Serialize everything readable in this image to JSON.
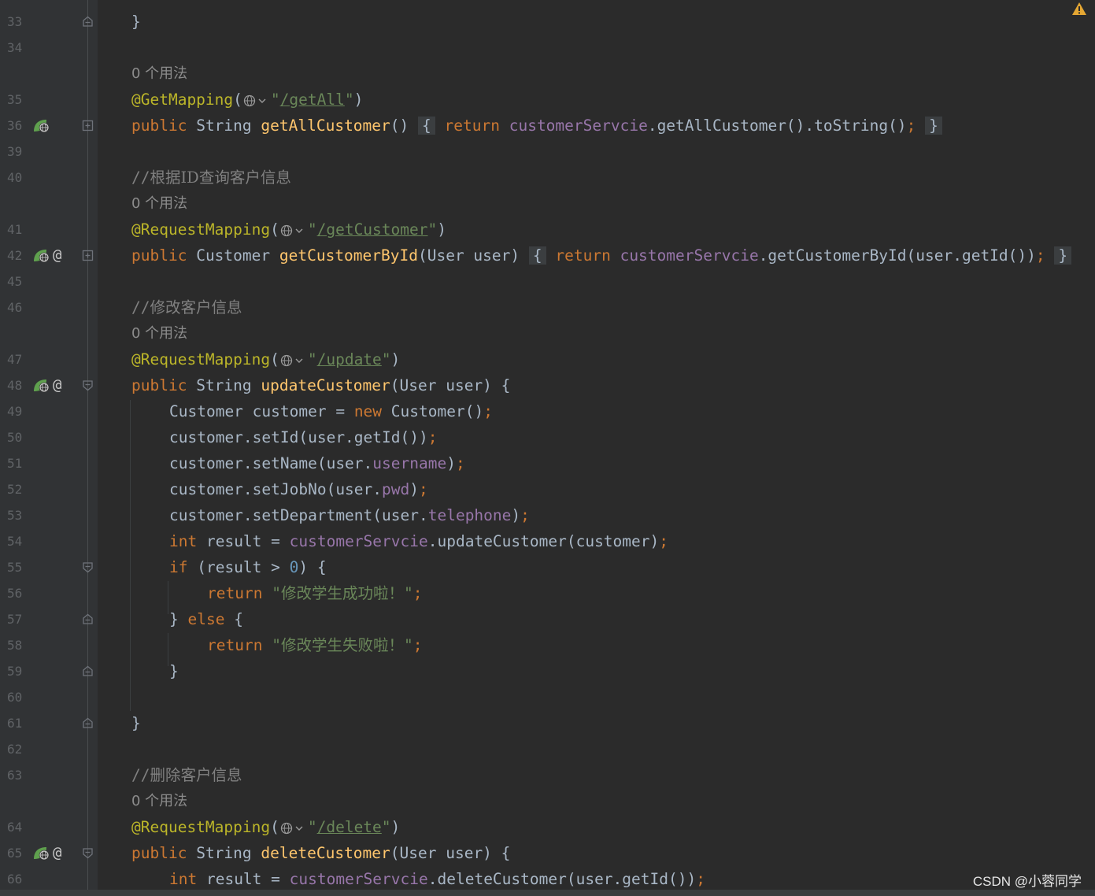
{
  "editor": {
    "usage_hint": "0 个用法",
    "lines": {
      "l33": {
        "num": "33",
        "code": "}"
      },
      "l34": {
        "num": "34"
      },
      "l35": {
        "num": "35",
        "ann": "@GetMapping",
        "url": "/getAll"
      },
      "l36": {
        "num": "36",
        "kw_public": "public",
        "type": "String",
        "method": "getAllCustomer",
        "kw_return": "return",
        "field": "customerServcie",
        "call": ".getAllCustomer().toString()",
        "semi": ";"
      },
      "l39": {
        "num": "39"
      },
      "l40": {
        "num": "40",
        "comment_prefix": "//",
        "comment": "根据ID查询客户信息"
      },
      "l41": {
        "num": "41",
        "ann": "@RequestMapping",
        "url": "/getCustomer"
      },
      "l42": {
        "num": "42",
        "kw_public": "public",
        "type": "Customer",
        "method": "getCustomerById",
        "params": "(User user)",
        "kw_return": "return",
        "field": "customerServcie",
        "call": ".getCustomerById(user.getId())",
        "semi": ";"
      },
      "l45": {
        "num": "45"
      },
      "l46": {
        "num": "46",
        "comment_prefix": "//",
        "comment": "修改客户信息"
      },
      "l47": {
        "num": "47",
        "ann": "@RequestMapping",
        "url": "/update"
      },
      "l48": {
        "num": "48",
        "kw_public": "public",
        "type": "String",
        "method": "updateCustomer",
        "params": "(User user) {"
      },
      "l49": {
        "num": "49",
        "a": "Customer customer = ",
        "kw": "new",
        "b": " Customer()",
        "semi": ";"
      },
      "l50": {
        "num": "50",
        "a": "customer.setId(user.getId())",
        "semi": ";"
      },
      "l51": {
        "num": "51",
        "a": "customer.setName(user.",
        "field": "username",
        "b": ")",
        "semi": ";"
      },
      "l52": {
        "num": "52",
        "a": "customer.setJobNo(user.",
        "field": "pwd",
        "b": ")",
        "semi": ";"
      },
      "l53": {
        "num": "53",
        "a": "customer.setDepartment(user.",
        "field": "telephone",
        "b": ")",
        "semi": ";"
      },
      "l54": {
        "num": "54",
        "kw": "int",
        "a": " result = ",
        "field": "customerServcie",
        "b": ".updateCustomer(customer)",
        "semi": ";"
      },
      "l55": {
        "num": "55",
        "kw": "if",
        "a": " (result > ",
        "number": "0",
        "b": ") {"
      },
      "l56": {
        "num": "56",
        "kw": "return",
        "str": "修改学生成功啦！",
        "semi": ";"
      },
      "l57": {
        "num": "57",
        "a": "} ",
        "kw": "else",
        "b": " {"
      },
      "l58": {
        "num": "58",
        "kw": "return",
        "str": "修改学生失败啦！",
        "semi": ";"
      },
      "l59": {
        "num": "59",
        "code": "}"
      },
      "l60": {
        "num": "60"
      },
      "l61": {
        "num": "61",
        "code": "}"
      },
      "l62": {
        "num": "62"
      },
      "l63": {
        "num": "63",
        "comment_prefix": "//",
        "comment": "删除客户信息"
      },
      "l64": {
        "num": "64",
        "ann": "@RequestMapping",
        "url": "/delete"
      },
      "l65": {
        "num": "65",
        "kw_public": "public",
        "type": "String",
        "method": "deleteCustomer",
        "params": "(User user) {"
      },
      "l66": {
        "num": "66",
        "kw": "int",
        "a": " result = ",
        "field": "customerServcie",
        "b": ".deleteCustomer(user.getId())",
        "semi": ";"
      }
    }
  },
  "watermark": "CSDN @小蓉同学",
  "icons": {
    "endpoint": "web-endpoint-icon",
    "at": "@",
    "fold_open": "fold-open-icon",
    "fold_close": "fold-close-icon",
    "fold_collapsed": "fold-collapsed-icon",
    "globe": "globe-dropdown-icon",
    "warning": "warning-icon"
  },
  "colors": {
    "background": "#2b2b2b",
    "gutter": "#313335",
    "keyword": "#cc7832",
    "annotation": "#bbb529",
    "string": "#6a8759",
    "method": "#ffc66d",
    "field": "#9876aa",
    "number": "#6897bb",
    "comment": "#808080",
    "text": "#a9b7c6"
  }
}
